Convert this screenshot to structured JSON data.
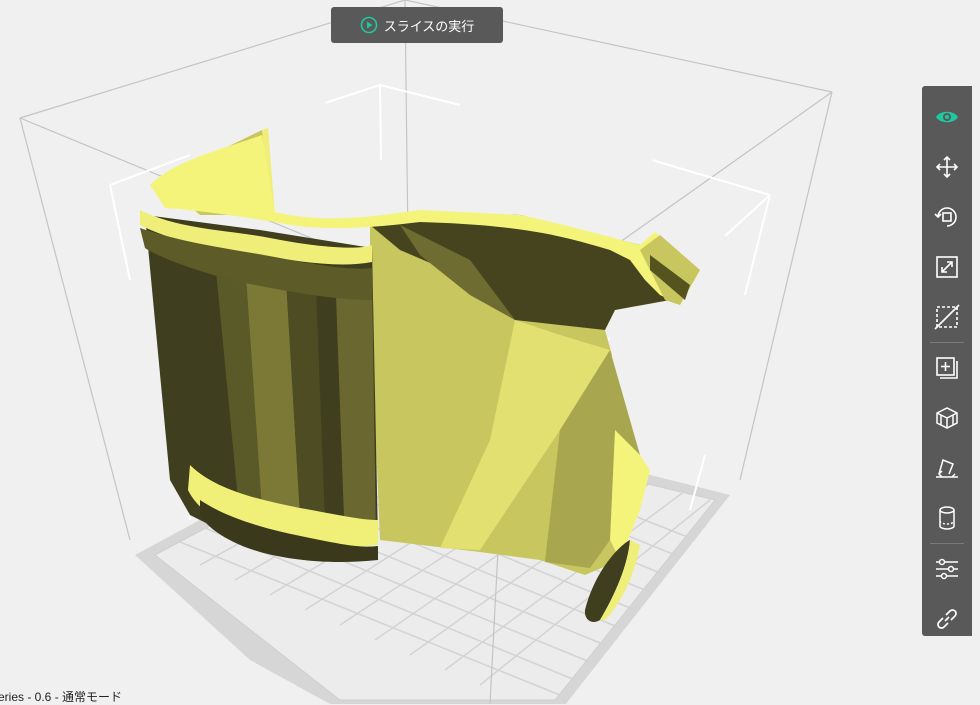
{
  "slice_button": {
    "label": "スライスの実行",
    "accent": "#1ec8a0"
  },
  "toolbar": {
    "items": [
      {
        "name": "view",
        "icon": "eye-icon"
      },
      {
        "name": "move",
        "icon": "move-icon"
      },
      {
        "name": "rotate",
        "icon": "rotate-icon"
      },
      {
        "name": "scale",
        "icon": "scale-icon"
      },
      {
        "name": "cut",
        "icon": "cut-icon"
      },
      {
        "name": "add-object",
        "icon": "add-object-icon"
      },
      {
        "name": "supports",
        "icon": "support-icon"
      },
      {
        "name": "lay-flat",
        "icon": "lay-flat-icon"
      },
      {
        "name": "variable-layer",
        "icon": "cylinder-icon"
      },
      {
        "name": "settings",
        "icon": "sliders-icon"
      },
      {
        "name": "link",
        "icon": "link-icon"
      }
    ],
    "active_color": "#1ec8a0",
    "icon_color": "#ffffff"
  },
  "status_bar": {
    "text": "eries - 0.6 - 通常モード"
  },
  "colors": {
    "background": "#f0f0f0",
    "model_light": "#c8c660",
    "model_dark": "#3e3d1f",
    "model_edge": "#f4f47a",
    "toolbar_bg": "#595959"
  }
}
